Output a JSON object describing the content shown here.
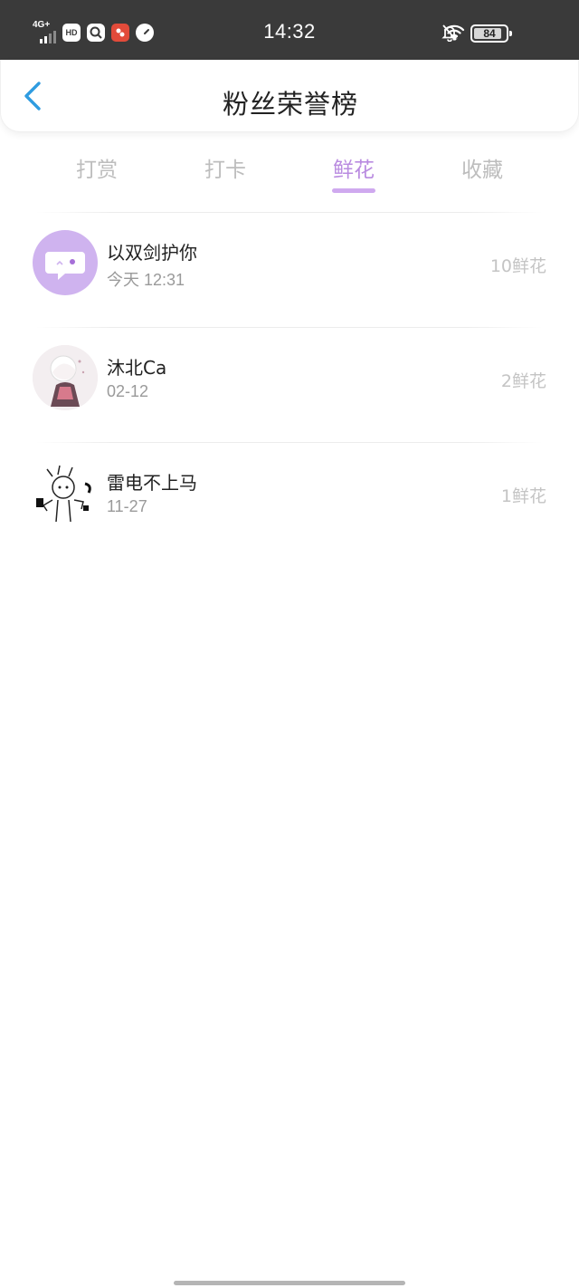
{
  "status_bar": {
    "network": "4G+",
    "time": "14:32",
    "battery": "84",
    "icons": [
      "hd-icon",
      "search-app-icon",
      "red-app-icon",
      "speedometer-icon",
      "bell-off-icon",
      "wifi-icon"
    ]
  },
  "header": {
    "title": "粉丝荣誉榜",
    "back_icon": "chevron-left-icon"
  },
  "tabs": [
    {
      "label": "打赏",
      "active": false
    },
    {
      "label": "打卡",
      "active": false
    },
    {
      "label": "鲜花",
      "active": true
    },
    {
      "label": "收藏",
      "active": false
    }
  ],
  "accent_color": "#b98be0",
  "fans": [
    {
      "name": "以双剑护你",
      "date": "今天 12:31",
      "count": "10鲜花"
    },
    {
      "name": "沐北Ca",
      "date": "02-12",
      "count": "2鲜花"
    },
    {
      "name": "雷电不上马",
      "date": "11-27",
      "count": "1鲜花"
    }
  ]
}
